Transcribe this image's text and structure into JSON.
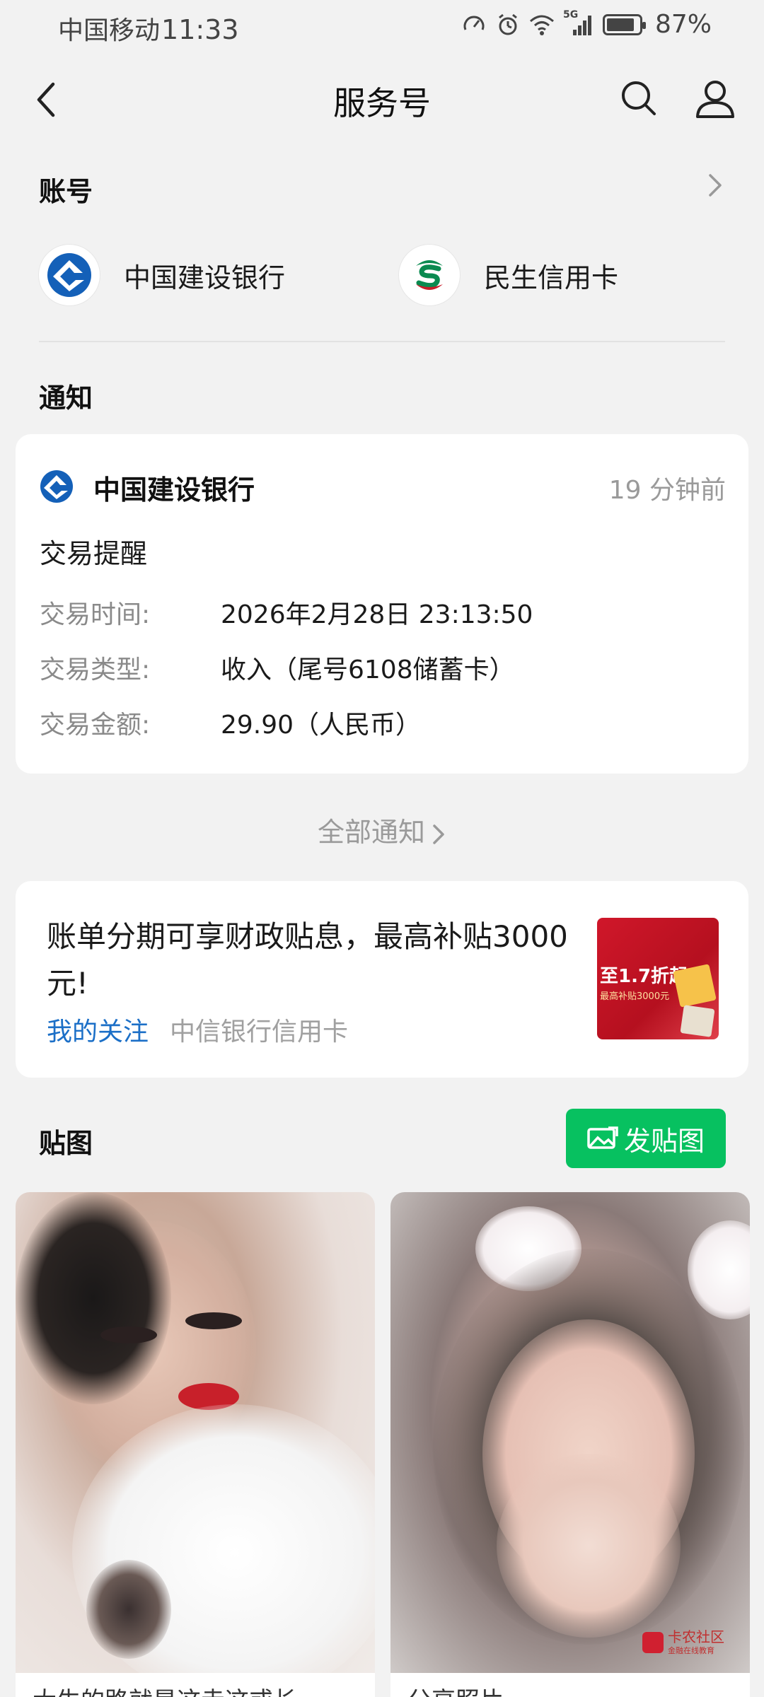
{
  "status_bar": {
    "carrier": "中国移动",
    "time": "11:33",
    "network": "5G",
    "battery_percent": "87%",
    "battery_level": 0.87,
    "icons": [
      "speed-icon",
      "alarm-icon",
      "wifi-icon",
      "signal-icon",
      "battery-icon"
    ]
  },
  "nav": {
    "title": "服务号",
    "icons": [
      "back-icon",
      "search-icon",
      "user-icon"
    ]
  },
  "accounts": {
    "title": "账号",
    "items": [
      {
        "name": "中国建设银行",
        "icon": "ccb-logo-icon",
        "color": "#1460b8"
      },
      {
        "name": "民生信用卡",
        "icon": "cmbc-logo-icon",
        "color": "#0a8a50"
      }
    ]
  },
  "notices": {
    "title": "通知",
    "card": {
      "bank": "中国建设银行",
      "time_ago": "19 分钟前",
      "type": "交易提醒",
      "rows": [
        {
          "label": "交易时间:",
          "value": "2026年2月28日 23:13:50"
        },
        {
          "label": "交易类型:",
          "value": "收入（尾号6108储蓄卡）"
        },
        {
          "label": "交易金额:",
          "value": "29.90（人民币）"
        }
      ]
    },
    "all_label": "全部通知"
  },
  "promo": {
    "title": "账单分期可享财政贴息，最高补贴3000元!",
    "follow_label": "我的关注",
    "source": "中信银行信用卡",
    "thumb_text": "至1.7折起",
    "thumb_sub": "最高补贴3000元"
  },
  "stickers": {
    "title": "贴图",
    "post_button": "发贴图",
    "watermark": "卡农社区",
    "watermark_sub": "金融在线教育",
    "captions": [
      "大生的路就是这走这或长",
      "分享照片"
    ]
  },
  "colors": {
    "accent_green": "#07c160",
    "link_blue": "#1b6fc7",
    "background": "#f2f2f2"
  }
}
